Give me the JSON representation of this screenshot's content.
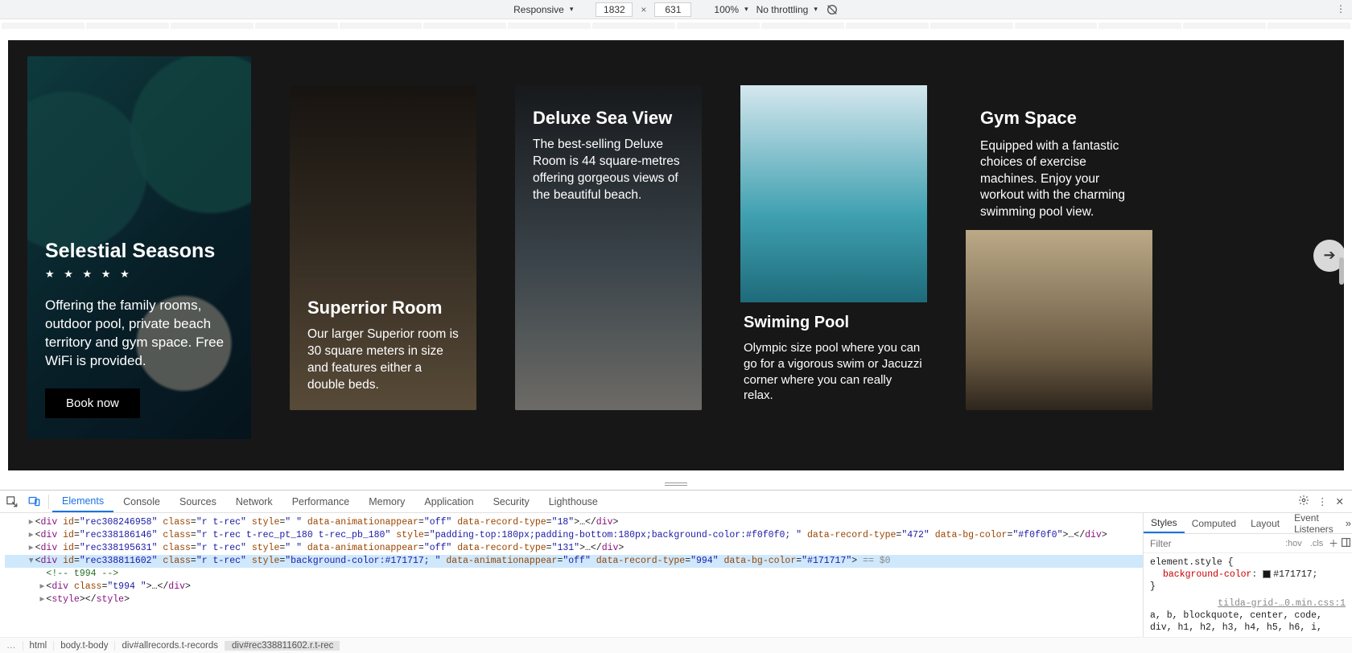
{
  "device_bar": {
    "mode": "Responsive",
    "width": "1832",
    "height": "631",
    "zoom": "100%",
    "throttling": "No throttling"
  },
  "cards": {
    "hero": {
      "title": "Selestial Seasons",
      "stars": "★ ★ ★ ★ ★",
      "desc": "Offering the family rooms, outdoor pool, private beach territory and gym space. Free WiFi is provided.",
      "cta": "Book now"
    },
    "c2": {
      "title": "Superrior Room",
      "desc": "Our larger Superior room is 30 square meters in size and features either a double beds."
    },
    "c3": {
      "title": "Deluxe Sea View",
      "desc": "The best-selling Deluxe Room is 44 square-metres offering gorgeous views of the beautiful beach."
    },
    "c4": {
      "title": "Swiming Pool",
      "desc": "Olympic size pool where you can go for a vigorous swim or Jacuzzi corner where you can really relax."
    },
    "c5": {
      "title": "Gym Space",
      "desc": "Equipped with a fantastic choices of exercise machines. Enjoy your workout with the charming swimming pool view."
    }
  },
  "devtools": {
    "tabs": [
      "Elements",
      "Console",
      "Sources",
      "Network",
      "Performance",
      "Memory",
      "Application",
      "Security",
      "Lighthouse"
    ],
    "active_tab": "Elements",
    "dom": [
      {
        "indent": 2,
        "arrow": "▸",
        "html": "<div id=\"rec308246958\" class=\"r t-rec\" style=\" \" data-animationappear=\"off\" data-record-type=\"18\">…</div>"
      },
      {
        "indent": 2,
        "arrow": "▸",
        "html": "<div id=\"rec338186146\" class=\"r t-rec t-rec_pt_180 t-rec_pb_180\" style=\"padding-top:180px;padding-bottom:180px;background-color:#f0f0f0; \" data-record-type=\"472\" data-bg-color=\"#f0f0f0\">…</div>"
      },
      {
        "indent": 2,
        "arrow": "▸",
        "html": "<div id=\"rec338195631\" class=\"r t-rec\" style=\" \" data-animationappear=\"off\" data-record-type=\"131\">…</div>"
      },
      {
        "indent": 2,
        "arrow": "▾",
        "sel": true,
        "html": "<div id=\"rec338811602\" class=\"r t-rec\" style=\"background-color:#171717; \" data-animationappear=\"off\" data-record-type=\"994\" data-bg-color=\"#171717\">",
        "eq0": true
      },
      {
        "indent": 3,
        "comment": "<!-- t994 -->"
      },
      {
        "indent": 3,
        "arrow": "▸",
        "html": "<div class=\"t994 \">…</div>"
      },
      {
        "indent": 3,
        "arrow": "▸",
        "html": "<style></style>"
      }
    ],
    "styles_tabs": [
      "Styles",
      "Computed",
      "Layout",
      "Event Listeners"
    ],
    "filter_placeholder": "Filter",
    "hov": ":hov",
    "cls": ".cls",
    "rule1_selector": "element.style {",
    "rule1_prop": "background-color",
    "rule1_val": "#171717",
    "rule1_swatch": "#171717",
    "rule2_src": "tilda-grid-…0.min.css:1",
    "rule2_sel": "a, b, blockquote, center, code, div, h1, h2, h3, h4, h5, h6, i,",
    "crumbs": [
      "html",
      "body.t-body",
      "div#allrecords.t-records",
      "div#rec338811602.r.t-rec"
    ]
  }
}
